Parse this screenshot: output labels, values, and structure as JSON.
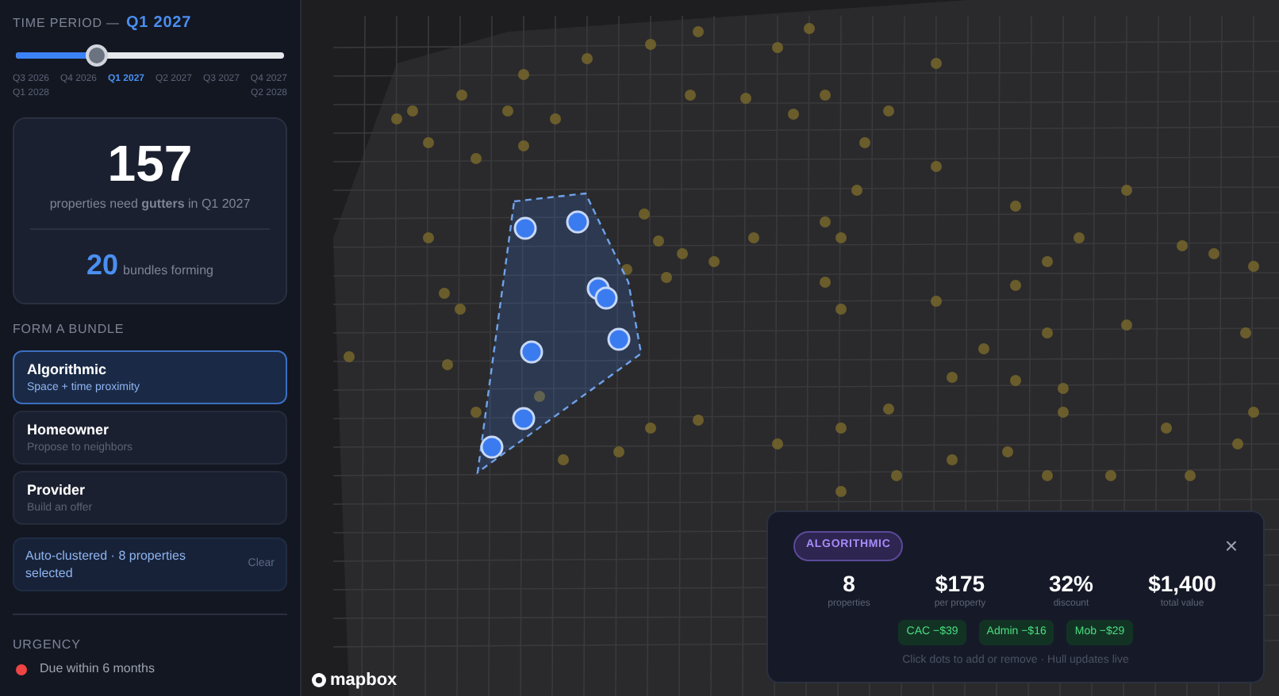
{
  "time_period": {
    "label": "TIME PERIOD —",
    "value": "Q1 2027",
    "level": 0.3,
    "ticks": [
      {
        "label": "Q3 2026",
        "selected": false
      },
      {
        "label": "Q4 2026",
        "selected": false
      },
      {
        "label": "Q1 2027",
        "selected": true
      },
      {
        "label": "Q2 2027",
        "selected": false
      },
      {
        "label": "Q3 2027",
        "selected": false
      },
      {
        "label": "Q4 2027",
        "selected": false
      },
      {
        "label": "Q1 2028",
        "selected": false
      },
      {
        "label": "Q2 2028",
        "selected": false
      }
    ]
  },
  "summary": {
    "count": "157",
    "caption": "properties need **gutters** in Q1 2027",
    "bundles": "20",
    "bundles_label": "bundles forming"
  },
  "form_bundle": {
    "heading": "FORM A BUNDLE",
    "options": [
      {
        "title": "Algorithmic",
        "subtitle": "Space + time proximity",
        "selected": true
      },
      {
        "title": "Homeowner",
        "subtitle": "Propose to neighbors",
        "selected": false
      },
      {
        "title": "Provider",
        "subtitle": "Build an offer",
        "selected": false
      }
    ],
    "status": "Auto-clustered · 8 properties selected",
    "clear": "Clear"
  },
  "urgency": {
    "heading": "URGENCY",
    "items": [
      {
        "label": "Due within 6 months",
        "color": "#ef4444"
      }
    ]
  },
  "map": {
    "attribution": "mapbox"
  },
  "bundle_panel": {
    "badge": "ALGORITHMIC",
    "close": "×",
    "stats": [
      {
        "value": "8",
        "label": "properties"
      },
      {
        "value": "$175",
        "label": "per property"
      },
      {
        "value": "32%",
        "label": "discount"
      },
      {
        "value": "$1,400",
        "label": "total value"
      }
    ],
    "savings": [
      "CAC −$39",
      "Admin −$16",
      "Mob −$29"
    ],
    "hint": "Click dots to add or remove · Hull updates live"
  }
}
